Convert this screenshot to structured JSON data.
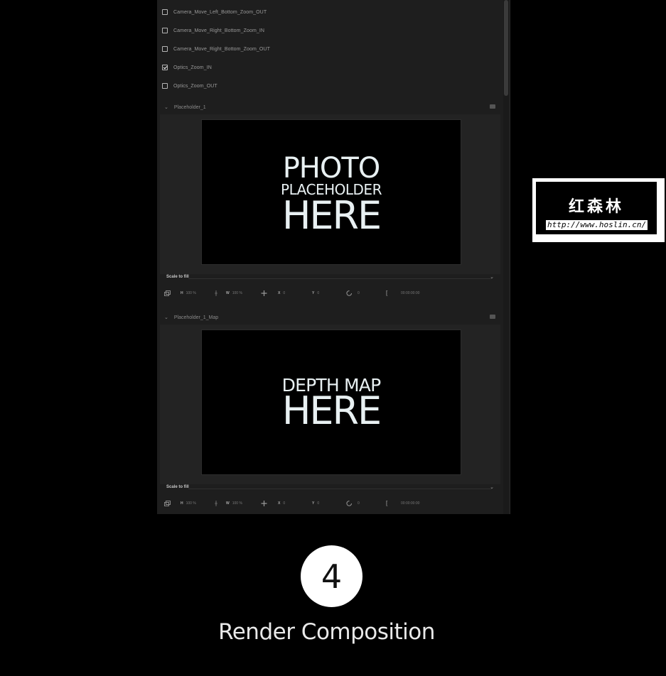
{
  "options": [
    {
      "label": "Camera_Move_Left_Bottom_Zoom_OUT",
      "checked": false
    },
    {
      "label": "Camera_Move_Right_Bottom_Zoom_IN",
      "checked": false
    },
    {
      "label": "Camera_Move_Right_Bottom_Zoom_OUT",
      "checked": false
    },
    {
      "label": "Optics_Zoom_IN",
      "checked": true
    },
    {
      "label": "Optics_Zoom_OUT",
      "checked": false
    }
  ],
  "sections": [
    {
      "title": "Placeholder_1",
      "preview_lines": [
        "PHOTO",
        "PLACEHOLDER",
        "HERE"
      ],
      "scale_mode": "Scale to fill",
      "controls": {
        "h_label": "H",
        "h_value": "100 %",
        "w_label": "W",
        "w_value": "100 %",
        "x_label": "X",
        "x_value": "0",
        "y_label": "Y",
        "y_value": "0",
        "rot_value": "0",
        "time": "00:00:00:00"
      }
    },
    {
      "title": "Placeholder_1_Map",
      "preview_lines": [
        "DEPTH MAP",
        "HERE"
      ],
      "scale_mode": "Scale to fill",
      "controls": {
        "h_label": "H",
        "h_value": "100 %",
        "w_label": "W",
        "w_value": "100 %",
        "x_label": "X",
        "x_value": "0",
        "y_label": "Y",
        "y_value": "0",
        "rot_value": "0",
        "time": "00:00:00:00"
      }
    }
  ],
  "step": {
    "number": "4",
    "caption": "Render Composition"
  },
  "watermark": {
    "title": "红森林",
    "url": "http://www.hoslin.cn/"
  },
  "colors": {
    "background": "#000000",
    "panel": "#1e1e1e",
    "text_on_preview": "#e8f0f2"
  }
}
